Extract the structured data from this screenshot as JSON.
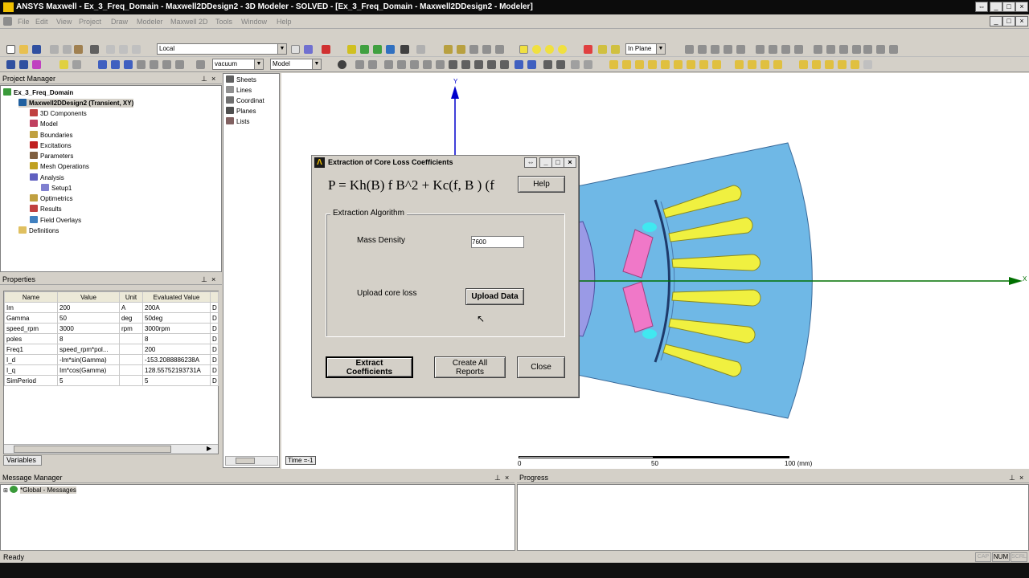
{
  "window": {
    "title": "ANSYS Maxwell - Ex_3_Freq_Domain - Maxwell2DDesign2 - 3D Modeler - SOLVED - [Ex_3_Freq_Domain - Maxwell2DDesign2 - Modeler]"
  },
  "menu": [
    "File",
    "Edit",
    "View",
    "Project",
    "Draw",
    "Modeler",
    "Maxwell 2D",
    "Tools",
    "Window",
    "Help"
  ],
  "toolbar": {
    "coord_system": "Local",
    "material": "vacuum",
    "model": "Model",
    "plane": "In Plane"
  },
  "project_manager": {
    "title": "Project Manager",
    "project": "Ex_3_Freq_Domain",
    "design": "Maxwell2DDesign2 (Transient, XY)",
    "items": [
      "3D Components",
      "Model",
      "Boundaries",
      "Excitations",
      "Parameters",
      "Mesh Operations",
      "Analysis",
      "Setup1",
      "Optimetrics",
      "Results",
      "Field Overlays",
      "Definitions"
    ]
  },
  "model_tree": {
    "items": [
      "Sheets",
      "Lines",
      "Coordinat",
      "Planes",
      "Lists"
    ]
  },
  "properties": {
    "title": "Properties",
    "headers": [
      "Name",
      "Value",
      "Unit",
      "Evaluated Value",
      ""
    ],
    "rows": [
      [
        "Im",
        "200",
        "A",
        "200A",
        "D"
      ],
      [
        "Gamma",
        "50",
        "deg",
        "50deg",
        "D"
      ],
      [
        "speed_rpm",
        "3000",
        "rpm",
        "3000rpm",
        "D"
      ],
      [
        "poles",
        "8",
        "",
        "8",
        "D"
      ],
      [
        "Freq1",
        "speed_rpm*pol...",
        "",
        "200",
        "D"
      ],
      [
        "I_d",
        "-Im*sin(Gamma)",
        "",
        "-153.2088886238A",
        "D"
      ],
      [
        "I_q",
        "Im*cos(Gamma)",
        "",
        "128.55752193731A",
        "D"
      ],
      [
        "SimPeriod",
        "5",
        "",
        "5",
        "D"
      ]
    ],
    "tab": "Variables"
  },
  "dialog": {
    "title": "Extraction of Core Loss Coefficients",
    "formula": "P = Kh(B) f B^2 + Kc(f, B ) (f",
    "help_label": "Help",
    "group_label": "Extraction Algorithm",
    "mass_density_label": "Mass Density",
    "mass_density_value": "7600",
    "upload_label": "Upload core loss",
    "upload_button": "Upload Data",
    "extract_line1": "Extract",
    "extract_line2": "Coefficients",
    "create_line1": "Create All",
    "create_line2": "Reports",
    "close_label": "Close"
  },
  "viewport": {
    "axis_y": "Y",
    "axis_x": "X",
    "time_label": "Time =-1",
    "scale_labels": [
      "0",
      "50",
      "100 (mm)"
    ]
  },
  "message_manager": {
    "title": "Message Manager",
    "item": "*Global - Messages"
  },
  "progress": {
    "title": "Progress"
  },
  "status": {
    "text": "Ready",
    "cap": "CAP",
    "num": "NUM",
    "scrl": "SCRL"
  },
  "colors": {
    "stator": "#6fb8e6",
    "airgap_rotor": "#9a9ae6",
    "magnet": "#f078c8",
    "slot": "#f0f040",
    "accent_cyan": "#40e8f0",
    "axis_blue": "#0000cc",
    "axis_green": "#007000"
  }
}
